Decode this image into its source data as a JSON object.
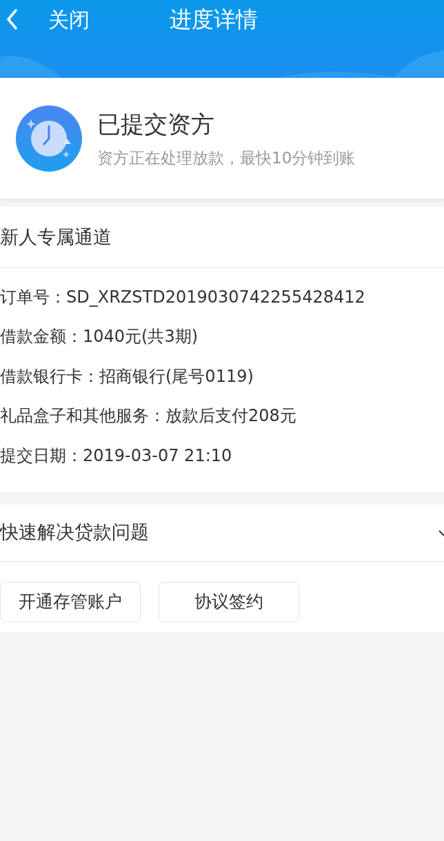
{
  "nav": {
    "close": "关闭",
    "title": "进度详情"
  },
  "status": {
    "title": "已提交资方",
    "subtitle": "资方正在处理放款，最快10分钟到账"
  },
  "channel": {
    "title": "新人专属通道",
    "rows": [
      {
        "label": "订单号：",
        "value": "SD_XRZSTD2019030742255428412"
      },
      {
        "label": "借款金额：",
        "value": "1040元(共3期)"
      },
      {
        "label": "借款银行卡：",
        "value": "招商银行(尾号0119)"
      },
      {
        "label": "礼品盒子和其他服务：",
        "value": "放款后支付208元"
      },
      {
        "label": "提交日期：",
        "value": "2019-03-07 21:10"
      }
    ]
  },
  "help": {
    "title": "快速解决贷款问题",
    "expanded": false,
    "buttons": [
      "开通存管账户",
      "协议签约"
    ]
  }
}
